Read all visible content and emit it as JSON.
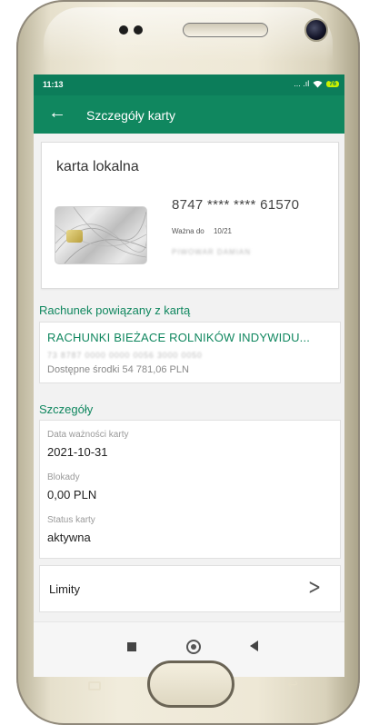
{
  "status_bar": {
    "time": "11:13",
    "signal": "... .ıl",
    "wifi_icon": "wifi-icon",
    "battery": "76"
  },
  "app_bar": {
    "back_icon": "arrow-left-icon",
    "title": "Szczegóły karty"
  },
  "card": {
    "name": "karta lokalna",
    "number": "8747 **** **** 61570",
    "valid_label": "Ważna do",
    "valid_value": "10/21",
    "holder": "PIWOWAR DAMIAN"
  },
  "account_section": {
    "heading": "Rachunek powiązany z kartą",
    "name": "RACHUNKI BIEŻACE ROLNIKÓW INDYWIDU...",
    "number": "73 8787 0000 0000 0056 3000 0050",
    "funds": "Dostępne środki 54 781,06 PLN"
  },
  "details_section": {
    "heading": "Szczegóły",
    "items": [
      {
        "label": "Data ważności karty",
        "value": "2021-10-31"
      },
      {
        "label": "Blokady",
        "value": "0,00 PLN"
      },
      {
        "label": "Status karty",
        "value": "aktywna"
      }
    ]
  },
  "limits": {
    "label": "Limity",
    "icon": "chevron-right-icon"
  },
  "colors": {
    "accent": "#10875f",
    "status_bar": "#0c7d5a",
    "battery": "#c9f000"
  }
}
